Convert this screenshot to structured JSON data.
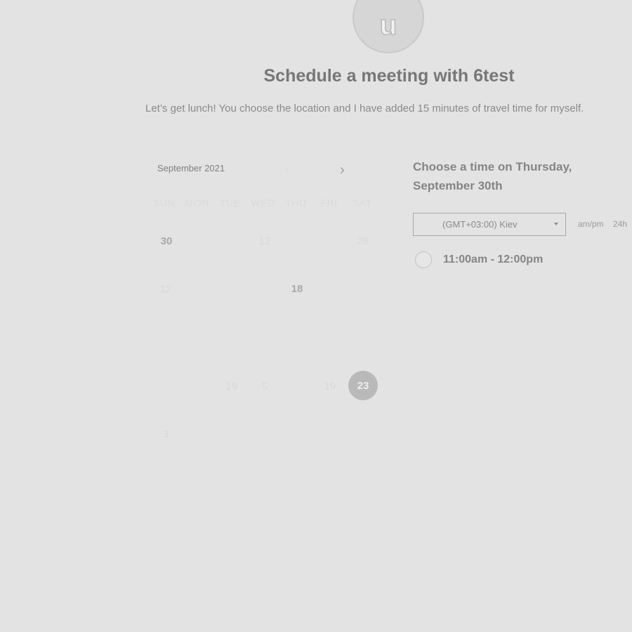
{
  "avatar": {
    "initial": "u"
  },
  "header": {
    "title": "Schedule a meeting with 6test",
    "subtitle": "Let’s get lunch! You choose the location and I have added 15 minutes of travel time for myself."
  },
  "calendar": {
    "month_label": "September 2021",
    "prev_icon": "‹",
    "next_icon": "›",
    "weekdays": [
      "SUN",
      "MON",
      "TUE",
      "WED",
      "THU",
      "FRI",
      "SAT"
    ],
    "days": [
      {
        "label": "30",
        "style": "bold"
      },
      {
        "label": "12",
        "style": "faint"
      },
      {
        "label": "28",
        "style": "faint"
      },
      {
        "label": "12",
        "style": "faint"
      },
      {
        "label": "18",
        "style": "bold"
      },
      {
        "label": "19",
        "style": "faint"
      },
      {
        "label": "5",
        "style": "faint"
      },
      {
        "label": "19",
        "style": "faint"
      },
      {
        "label": "23",
        "style": "selected"
      },
      {
        "label": "3",
        "style": "faint"
      }
    ]
  },
  "times": {
    "heading": "Choose a time on Thursday, September 30th",
    "timezone": "(GMT+03:00) Kiev",
    "format_ampm": "am/pm",
    "format_24h": "24h",
    "slots": [
      {
        "label": "11:00am - 12:00pm"
      }
    ]
  }
}
